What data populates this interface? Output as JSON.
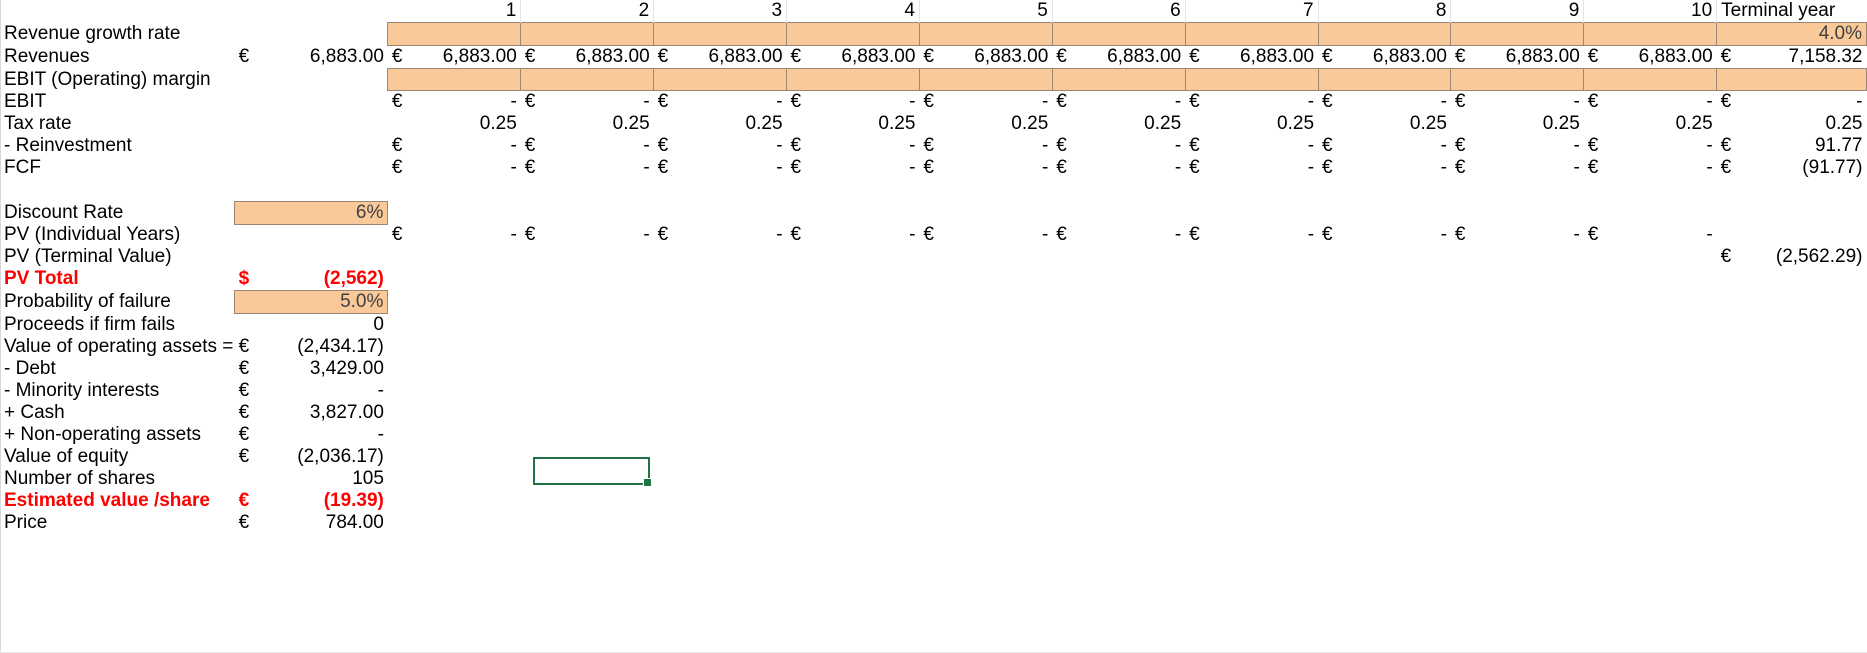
{
  "sheet": {
    "currency_symbol": "€",
    "dollar_symbol": "$",
    "dash": "-",
    "blank": "",
    "accent_orange": "#FAC999",
    "selection_green": "#217346",
    "negative_red": "#FF0000"
  },
  "columns": {
    "year_headers": [
      "1",
      "2",
      "3",
      "4",
      "5",
      "6",
      "7",
      "8",
      "9",
      "10"
    ],
    "terminal_header": "Terminal year"
  },
  "rows": {
    "revenue_growth": {
      "label": "Revenue growth rate",
      "base_cur": "",
      "base_val": "",
      "years": [
        "",
        "",
        "",
        "",
        "",
        "",
        "",
        "",
        "",
        ""
      ],
      "terminal": "4.0%"
    },
    "revenues": {
      "label": "Revenues",
      "base_cur": "€",
      "base_val": "6,883.00",
      "years": [
        "6,883.00",
        "6,883.00",
        "6,883.00",
        "6,883.00",
        "6,883.00",
        "6,883.00",
        "6,883.00",
        "6,883.00",
        "6,883.00",
        "6,883.00"
      ],
      "terminal": "7,158.32",
      "terminal_cur": "€",
      "year_cur": "€"
    },
    "ebit_margin": {
      "label": "EBIT (Operating) margin",
      "base_cur": "",
      "base_val": "",
      "years": [
        "",
        "",
        "",
        "",
        "",
        "",
        "",
        "",
        "",
        ""
      ],
      "terminal": ""
    },
    "ebit": {
      "label": "EBIT",
      "base_cur": "",
      "base_val": "",
      "years": [
        "-",
        "-",
        "-",
        "-",
        "-",
        "-",
        "-",
        "-",
        "-",
        "-"
      ],
      "terminal": "-",
      "terminal_cur": "€",
      "year_cur": "€"
    },
    "tax_rate": {
      "label": "Tax rate",
      "base_cur": "",
      "base_val": "",
      "years": [
        "0.25",
        "0.25",
        "0.25",
        "0.25",
        "0.25",
        "0.25",
        "0.25",
        "0.25",
        "0.25",
        "0.25"
      ],
      "terminal": "0.25",
      "terminal_cur": "",
      "year_cur": ""
    },
    "reinvestment": {
      "label": " -  Reinvestment",
      "base_cur": "",
      "base_val": "",
      "years": [
        "-",
        "-",
        "-",
        "-",
        "-",
        "-",
        "-",
        "-",
        "-",
        "-"
      ],
      "terminal": "91.77",
      "terminal_cur": "€",
      "year_cur": "€"
    },
    "fcf": {
      "label": "FCF",
      "base_cur": "",
      "base_val": "",
      "years": [
        "-",
        "-",
        "-",
        "-",
        "-",
        "-",
        "-",
        "-",
        "-",
        "-"
      ],
      "terminal": "(91.77)",
      "terminal_cur": "€",
      "year_cur": "€"
    },
    "discount_rate": {
      "label": "Discount Rate",
      "value": "6%"
    },
    "pv_individual_years": {
      "label": "PV (Individual Years)",
      "years": [
        "-",
        "-",
        "-",
        "-",
        "-",
        "-",
        "-",
        "-",
        "-",
        "-"
      ],
      "year_cur": "€"
    },
    "pv_terminal_value": {
      "label": "PV (Terminal Value)",
      "cur": "€",
      "value": "(2,562.29)"
    },
    "pv_total": {
      "label": "PV Total",
      "cur": "$",
      "value": "(2,562)"
    },
    "probability_of_failure": {
      "label": "Probability of failure",
      "value": "5.0%"
    },
    "proceeds_if_firm_fails": {
      "label": "Proceeds if firm fails",
      "cur": "",
      "value": "0"
    },
    "value_of_operating_assets": {
      "label": "Value of operating assets =",
      "cur": "€",
      "value": "(2,434.17)"
    },
    "debt": {
      "label": " -  Debt",
      "cur": "€",
      "value": "3,429.00"
    },
    "minority_interests": {
      "label": " -  Minority interests",
      "cur": "€",
      "value": "-"
    },
    "cash": {
      "label": " +  Cash",
      "cur": "€",
      "value": "3,827.00"
    },
    "non_operating_assets": {
      "label": " + Non-operating assets",
      "cur": "€",
      "value": "-"
    },
    "value_of_equity": {
      "label": "Value of equity",
      "cur": "€",
      "value": "(2,036.17)"
    },
    "number_of_shares": {
      "label": "Number of shares",
      "cur": "",
      "value": "105"
    },
    "estimated_value_per_share": {
      "label": "Estimated value /share",
      "cur": "€",
      "value": "(19.39)"
    },
    "price": {
      "label": "Price",
      "cur": "€",
      "value": "784.00"
    }
  }
}
